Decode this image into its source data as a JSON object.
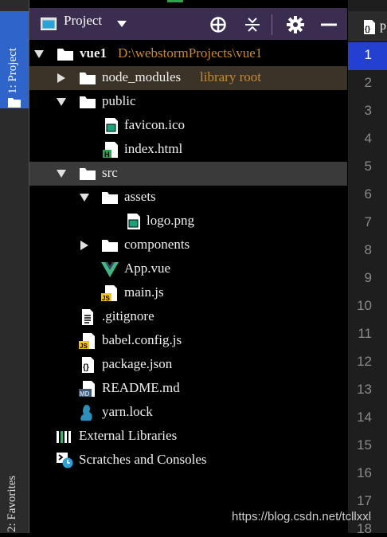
{
  "window": {
    "accent": "#2f65ca",
    "header_bg": "#3b2d4f",
    "folder_color": "#ffffff",
    "extra_color": "#c9892e"
  },
  "left_tool_strip": {
    "project_tab_label": "1: Project",
    "favorites_tab_label": "2: Favorites"
  },
  "panel": {
    "view_title": "Project",
    "header_buttons": [
      "locate-icon",
      "collapse-all-icon",
      "gear-icon",
      "minimize-icon"
    ]
  },
  "tree": [
    {
      "name": "vue1",
      "extra": "D:\\webstormProjects\\vue1",
      "icon": "folder-icon",
      "expanded": true,
      "depth": 0
    },
    {
      "name": "node_modules",
      "extra": "library root",
      "icon": "folder-icon",
      "expanded": false,
      "depth": 1
    },
    {
      "name": "public",
      "icon": "folder-icon",
      "expanded": true,
      "depth": 1
    },
    {
      "name": "favicon.ico",
      "icon": "image-file-icon",
      "depth": 2
    },
    {
      "name": "index.html",
      "icon": "html-file-icon",
      "depth": 2
    },
    {
      "name": "src",
      "icon": "folder-icon",
      "expanded": true,
      "depth": 1
    },
    {
      "name": "assets",
      "icon": "folder-icon",
      "expanded": true,
      "depth": 2
    },
    {
      "name": "logo.png",
      "icon": "image-file-icon",
      "depth": 3
    },
    {
      "name": "components",
      "icon": "folder-icon",
      "expanded": false,
      "depth": 2
    },
    {
      "name": "App.vue",
      "icon": "vue-file-icon",
      "depth": 2
    },
    {
      "name": "main.js",
      "icon": "js-file-icon",
      "depth": 2
    },
    {
      "name": ".gitignore",
      "icon": "text-file-icon",
      "depth": 1
    },
    {
      "name": "babel.config.js",
      "icon": "js-file-icon",
      "depth": 1
    },
    {
      "name": "package.json",
      "icon": "json-file-icon",
      "depth": 1
    },
    {
      "name": "README.md",
      "icon": "markdown-file-icon",
      "depth": 1
    },
    {
      "name": "yarn.lock",
      "icon": "yarn-file-icon",
      "depth": 1
    },
    {
      "name": "External Libraries",
      "icon": "libraries-icon",
      "depth": 0
    },
    {
      "name": "Scratches and Consoles",
      "icon": "scratches-icon",
      "depth": 0
    }
  ],
  "editor": {
    "tab_text": "p",
    "line_numbers": [
      "1",
      "2",
      "3",
      "4",
      "5",
      "6",
      "7",
      "8",
      "9",
      "10",
      "11",
      "12",
      "13",
      "14",
      "15",
      "16",
      "17",
      "18"
    ],
    "active_line": "1"
  },
  "watermark": "https://blog.csdn.net/tcllxxl"
}
